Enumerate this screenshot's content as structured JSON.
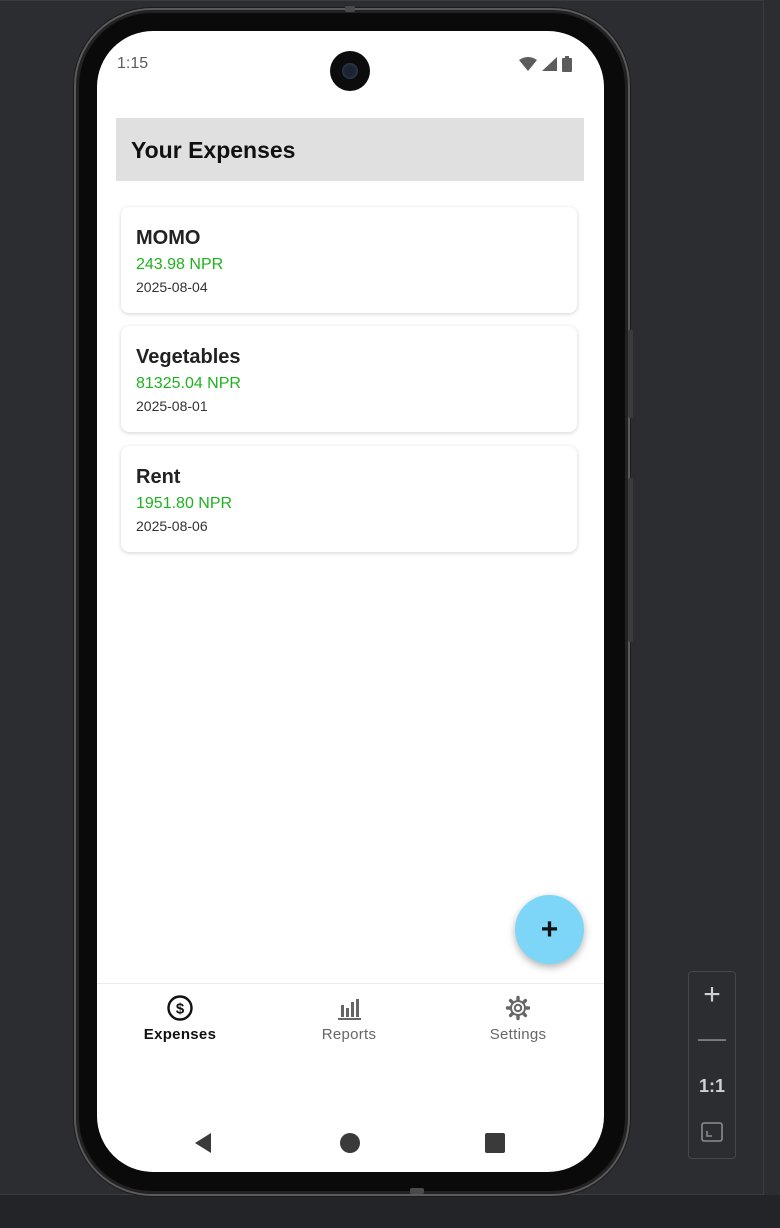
{
  "status_bar": {
    "time": "1:15"
  },
  "header": {
    "title": "Your Expenses"
  },
  "expenses": [
    {
      "title": "MOMO",
      "amount": "243.98 NPR",
      "date": "2025-08-04"
    },
    {
      "title": "Vegetables",
      "amount": "81325.04 NPR",
      "date": "2025-08-01"
    },
    {
      "title": "Rent",
      "amount": "1951.80 NPR",
      "date": "2025-08-06"
    }
  ],
  "fab": {
    "label": "+"
  },
  "bottom_nav": {
    "items": [
      {
        "label": "Expenses",
        "icon": "dollar-circle-icon",
        "active": true
      },
      {
        "label": "Reports",
        "icon": "bar-chart-icon",
        "active": false
      },
      {
        "label": "Settings",
        "icon": "gear-icon",
        "active": false
      }
    ]
  },
  "zoom_controls": {
    "zoom_in": "+",
    "zoom_out": "—",
    "ratio": "1:1"
  },
  "colors": {
    "amount_green": "#1fb21f",
    "fab_blue": "#7dd6f8",
    "header_gray": "#e0e0e0"
  }
}
